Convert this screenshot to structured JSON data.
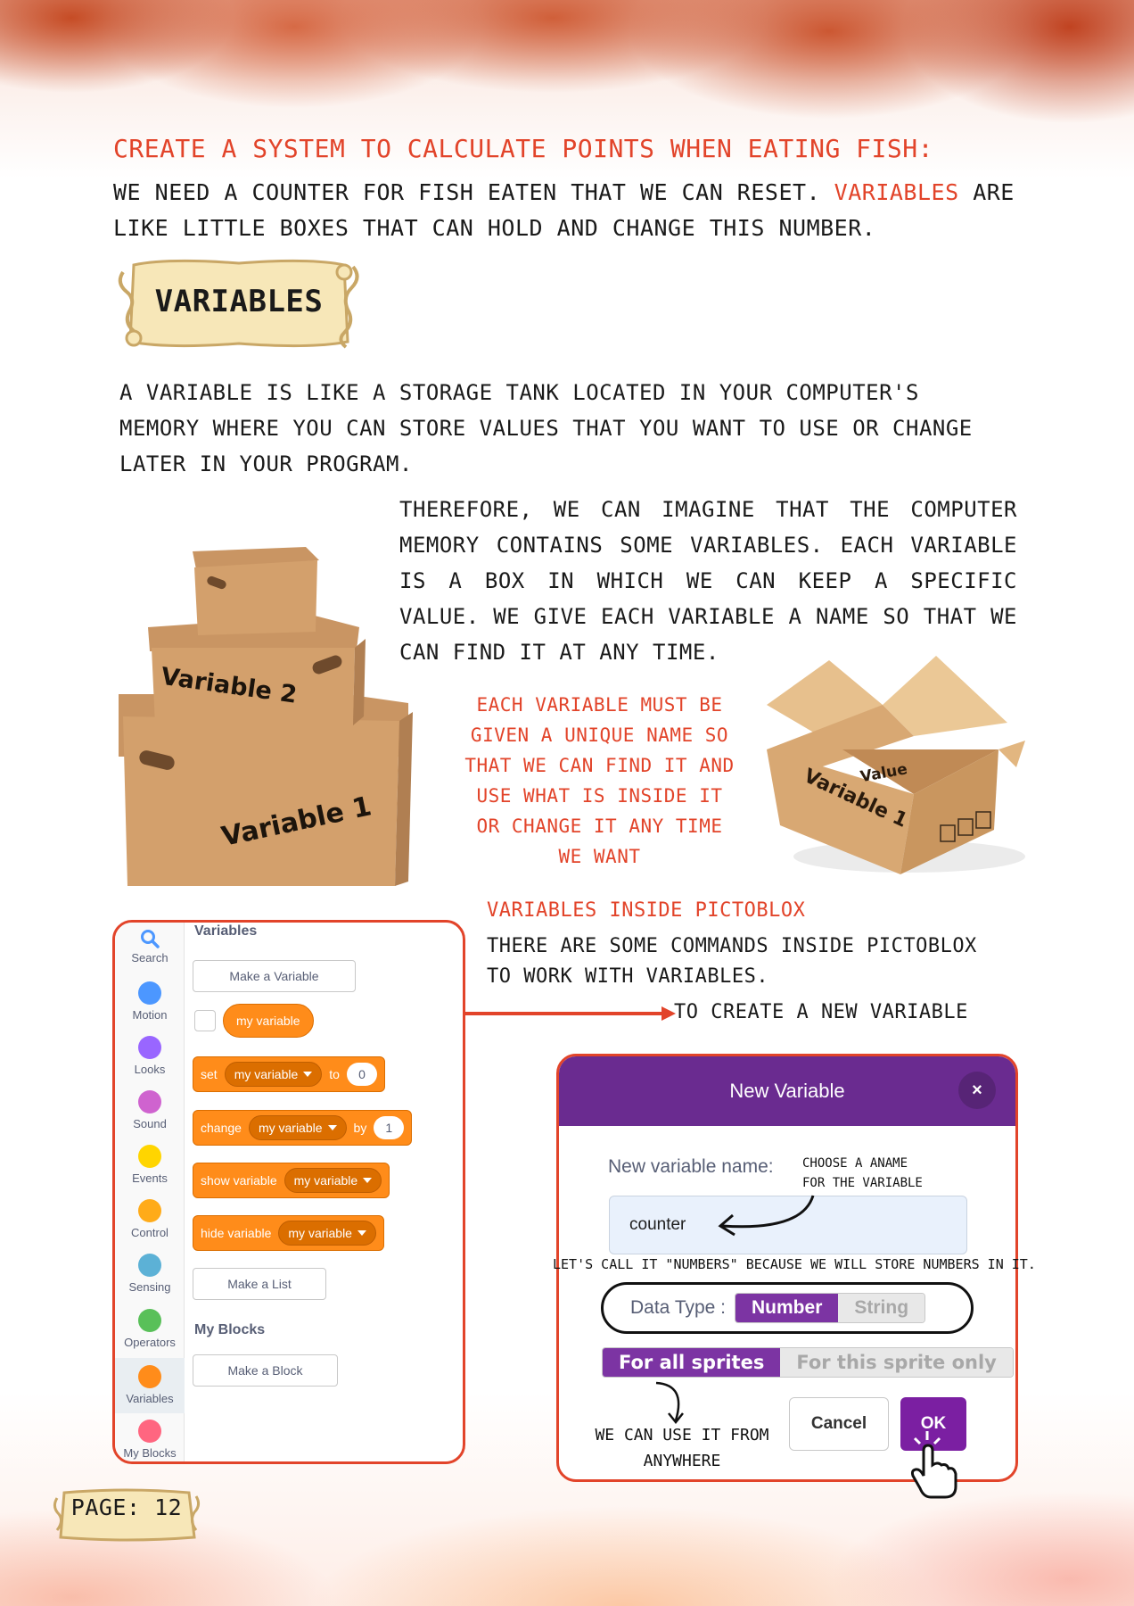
{
  "heading": "CREATE A SYSTEM TO CALCULATE POINTS WHEN EATING FISH:",
  "intro": {
    "before": "WE NEED A COUNTER FOR FISH EATEN THAT WE CAN RESET. ",
    "highlight": "VARIABLES",
    "after": " ARE LIKE LITTLE BOXES THAT CAN HOLD AND CHANGE THIS NUMBER."
  },
  "section_title": "VARIABLES",
  "paragraph1": "A VARIABLE IS LIKE A STORAGE TANK LOCATED IN YOUR COMPUTER'S MEMORY WHERE YOU CAN STORE VALUES THAT YOU WANT TO USE OR CHANGE LATER IN YOUR PROGRAM.",
  "paragraph2": "THEREFORE, WE CAN IMAGINE THAT THE COMPUTER MEMORY CONTAINS SOME VARIABLES. EACH VARIABLE IS A BOX IN WHICH WE CAN KEEP A SPECIFIC VALUE. WE GIVE EACH VARIABLE A NAME SO THAT WE CAN FIND IT AT ANY TIME.",
  "red_note": "EACH VARIABLE MUST BE GIVEN A UNIQUE NAME SO THAT WE CAN FIND IT AND USE WHAT IS INSIDE IT OR CHANGE IT ANY TIME WE WANT",
  "boxes_illustration": {
    "box_top_label": "Variable 2",
    "box_bottom_label": "Variable 1"
  },
  "open_box_illustration": {
    "value_label": "Value",
    "name_label": "Variable 1"
  },
  "pictoblox": {
    "title": "VARIABLES INSIDE PICTOBLOX",
    "text": "THERE ARE SOME COMMANDS INSIDE PICTOBLOX TO WORK WITH VARIABLES.",
    "create_label": "TO CREATE A NEW VARIABLE"
  },
  "palette": {
    "categories": [
      {
        "label": "Search",
        "color": "#4c97ff",
        "icon": "search-icon"
      },
      {
        "label": "Motion",
        "color": "#4c97ff"
      },
      {
        "label": "Looks",
        "color": "#9966ff"
      },
      {
        "label": "Sound",
        "color": "#cf63cf"
      },
      {
        "label": "Events",
        "color": "#ffd500"
      },
      {
        "label": "Control",
        "color": "#ffab19"
      },
      {
        "label": "Sensing",
        "color": "#5cb1d6"
      },
      {
        "label": "Operators",
        "color": "#59c059"
      },
      {
        "label": "Variables",
        "color": "#ff8c1a"
      },
      {
        "label": "My Blocks",
        "color": "#ff6680"
      }
    ],
    "variables_heading": "Variables",
    "make_variable": "Make a Variable",
    "reporter": "my variable",
    "set_block": {
      "verb": "set",
      "var": "my variable",
      "prep": "to",
      "value": "0"
    },
    "change_block": {
      "verb": "change",
      "var": "my variable",
      "prep": "by",
      "value": "1"
    },
    "show_block": {
      "verb": "show variable",
      "var": "my variable"
    },
    "hide_block": {
      "verb": "hide variable",
      "var": "my variable"
    },
    "make_list": "Make a List",
    "myblocks_heading": "My Blocks",
    "make_block": "Make a Block",
    "accent_color": "#ff8c1a"
  },
  "dialog": {
    "title": "New Variable",
    "close": "×",
    "name_label": "New variable name:",
    "name_value": "counter",
    "data_type_label": "Data Type :",
    "type_number": "Number",
    "type_string": "String",
    "scope_all": "For all sprites",
    "scope_this": "For this sprite only",
    "cancel": "Cancel",
    "ok": "OK",
    "header_color": "#6a2b90"
  },
  "annotations": {
    "choose_name": "CHOOSE A ANAME FOR THE VARIABLE",
    "lets_call": "LET'S CALL IT \"NUMBERS\" BECAUSE WE WILL STORE NUMBERS IN IT.",
    "anywhere": "WE CAN USE IT FROM ANYWHERE"
  },
  "page_label": "PAGE: 12"
}
